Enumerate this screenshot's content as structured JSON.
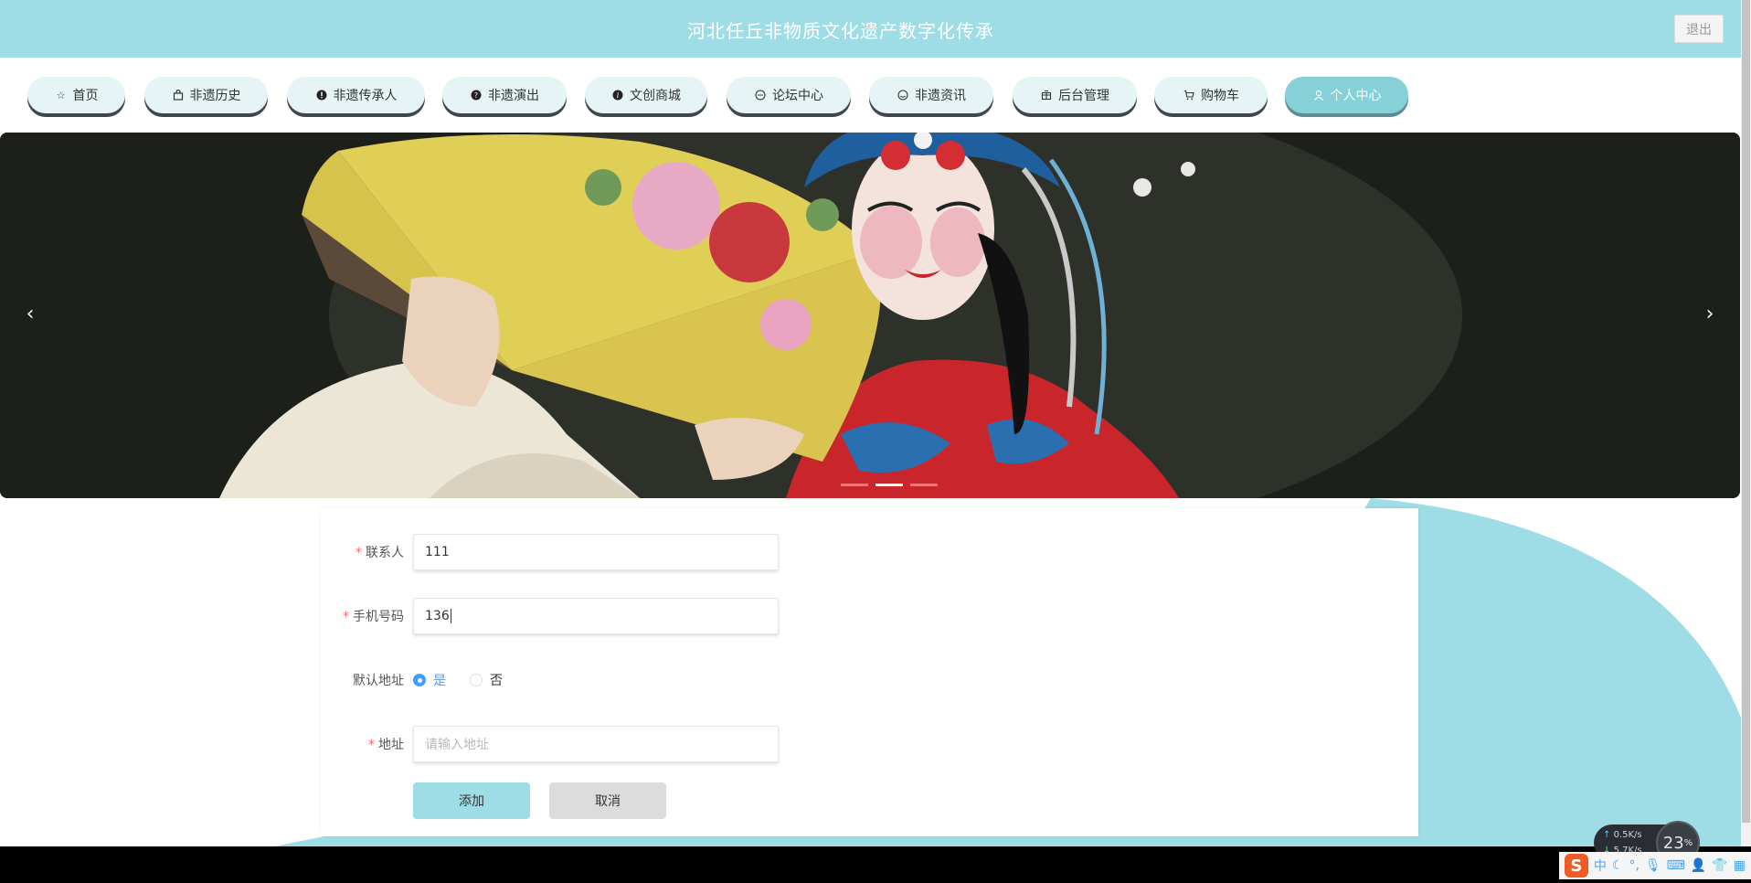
{
  "header": {
    "title": "河北任丘非物质文化遗产数字化传承",
    "logout_label": "退出"
  },
  "nav": {
    "items": [
      {
        "label": "首页",
        "icon": "star-icon"
      },
      {
        "label": "非遗历史",
        "icon": "bag-icon"
      },
      {
        "label": "非遗传承人",
        "icon": "exclamation-icon"
      },
      {
        "label": "非遗演出",
        "icon": "question-icon"
      },
      {
        "label": "文创商城",
        "icon": "info-icon"
      },
      {
        "label": "论坛中心",
        "icon": "chat-icon"
      },
      {
        "label": "非遗资讯",
        "icon": "smile-icon"
      },
      {
        "label": "后台管理",
        "icon": "box-icon"
      },
      {
        "label": "购物车",
        "icon": "cart-icon"
      },
      {
        "label": "个人中心",
        "icon": "user-icon"
      }
    ],
    "active_index": 9
  },
  "banner": {
    "prev_icon": "chevron-left-icon",
    "next_icon": "chevron-right-icon",
    "slide_count": 3,
    "active_slide": 1
  },
  "form": {
    "contact": {
      "label": "联系人",
      "value": "111",
      "required": true
    },
    "phone": {
      "label": "手机号码",
      "value": "136",
      "required": true
    },
    "default_address": {
      "label": "默认地址",
      "options": [
        "是",
        "否"
      ],
      "selected": "是"
    },
    "address": {
      "label": "地址",
      "value": "",
      "placeholder": "请输入地址",
      "required": true
    },
    "submit_label": "添加",
    "cancel_label": "取消"
  },
  "tray": {
    "upload_speed": "0.5",
    "download_speed": "5.7",
    "speed_unit": "K/s",
    "cpu_percent": "23",
    "cpu_unit": "%",
    "ime_label": "中"
  },
  "colors": {
    "header_bg": "#9edde6",
    "active_nav": "#86d0d8",
    "radio_accent": "#409eff",
    "required_star": "#f56c6c"
  }
}
